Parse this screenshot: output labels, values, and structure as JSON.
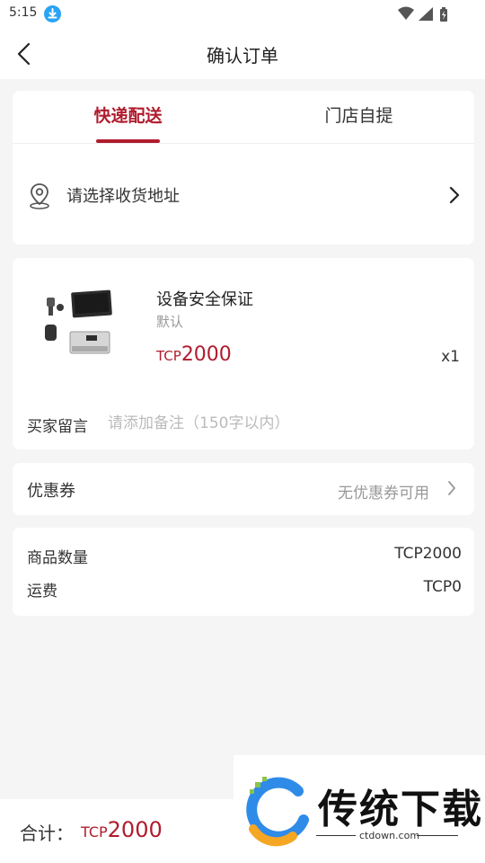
{
  "status_bar": {
    "time": "5:15"
  },
  "nav": {
    "title": "确认订单"
  },
  "delivery_tabs": [
    {
      "label": "快递配送",
      "active": true
    },
    {
      "label": "门店自提",
      "active": false
    }
  ],
  "address": {
    "label": "请选择收货地址"
  },
  "product": {
    "name": "设备安全保证",
    "spec": "默认",
    "price_currency": "TCP",
    "price_amount": "2000",
    "quantity": "x1"
  },
  "remark": {
    "label": "买家留言",
    "placeholder": "请添加备注（150字以内）"
  },
  "coupon": {
    "label": "优惠券",
    "value": "无优惠券可用"
  },
  "summary": [
    {
      "label": "商品数量",
      "value": "TCP2000"
    },
    {
      "label": "运费",
      "value": "TCP0"
    }
  ],
  "total": {
    "label": "合计：",
    "currency": "TCP",
    "amount": "2000"
  },
  "watermark": {
    "name": "传统下载",
    "site": "ctdown.com"
  },
  "colors": {
    "accent": "#b01c2e",
    "background": "#f5f5f5",
    "card": "#ffffff",
    "muted": "#999999"
  }
}
